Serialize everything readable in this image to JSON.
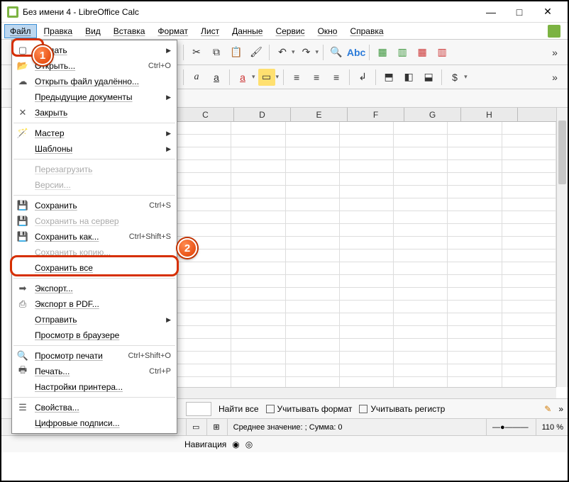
{
  "window": {
    "title": "Без имени 4 - LibreOffice Calc"
  },
  "menubar": [
    "Файл",
    "Правка",
    "Вид",
    "Вставка",
    "Формат",
    "Лист",
    "Данные",
    "Сервис",
    "Окно",
    "Справка"
  ],
  "file_menu": [
    {
      "icon": "new",
      "label": "Создать",
      "shortcut": "",
      "sub": true
    },
    {
      "icon": "open",
      "label": "Открыть...",
      "shortcut": "Ctrl+O"
    },
    {
      "icon": "open-remote",
      "label": "Открыть файл удалённо..."
    },
    {
      "icon": "recent",
      "label": "Предыдущие документы",
      "sub": true
    },
    {
      "icon": "close",
      "label": "Закрыть"
    },
    {
      "sep": true
    },
    {
      "icon": "wizard",
      "label": "Мастер",
      "sub": true
    },
    {
      "icon": "",
      "label": "Шаблоны",
      "sub": true
    },
    {
      "sep": true
    },
    {
      "icon": "",
      "label": "Перезагрузить",
      "disabled": true
    },
    {
      "icon": "",
      "label": "Версии...",
      "disabled": true
    },
    {
      "sep": true
    },
    {
      "icon": "save",
      "label": "Сохранить",
      "shortcut": "Ctrl+S"
    },
    {
      "icon": "save-remote",
      "label": "Сохранить на сервер",
      "disabled": true
    },
    {
      "icon": "saveas",
      "label": "Сохранить как...",
      "shortcut": "Ctrl+Shift+S"
    },
    {
      "icon": "",
      "label": "Сохранить копию...",
      "disabled": true
    },
    {
      "icon": "",
      "label": "Сохранить все"
    },
    {
      "sep": true
    },
    {
      "icon": "export",
      "label": "Экспорт..."
    },
    {
      "icon": "pdf",
      "label": "Экспорт в PDF..."
    },
    {
      "icon": "",
      "label": "Отправить",
      "sub": true
    },
    {
      "icon": "",
      "label": "Просмотр в браузере"
    },
    {
      "sep": true
    },
    {
      "icon": "preview",
      "label": "Просмотр печати",
      "shortcut": "Ctrl+Shift+O"
    },
    {
      "icon": "print",
      "label": "Печать...",
      "shortcut": "Ctrl+P"
    },
    {
      "icon": "",
      "label": "Настройки принтера..."
    },
    {
      "sep": true
    },
    {
      "icon": "props",
      "label": "Свойства..."
    },
    {
      "icon": "",
      "label": "Цифровые подписи..."
    }
  ],
  "columns": [
    "C",
    "D",
    "E",
    "F",
    "G",
    "H"
  ],
  "findbar": {
    "find_all": "Найти все",
    "match_format": "Учитывать формат",
    "match_case": "Учитывать регистр"
  },
  "statusbar": {
    "summary": "Среднее значение: ; Сумма: 0",
    "zoom": "110 %"
  },
  "navbar": {
    "label": "Навигация"
  },
  "badges": {
    "b1": "1",
    "b2": "2"
  }
}
